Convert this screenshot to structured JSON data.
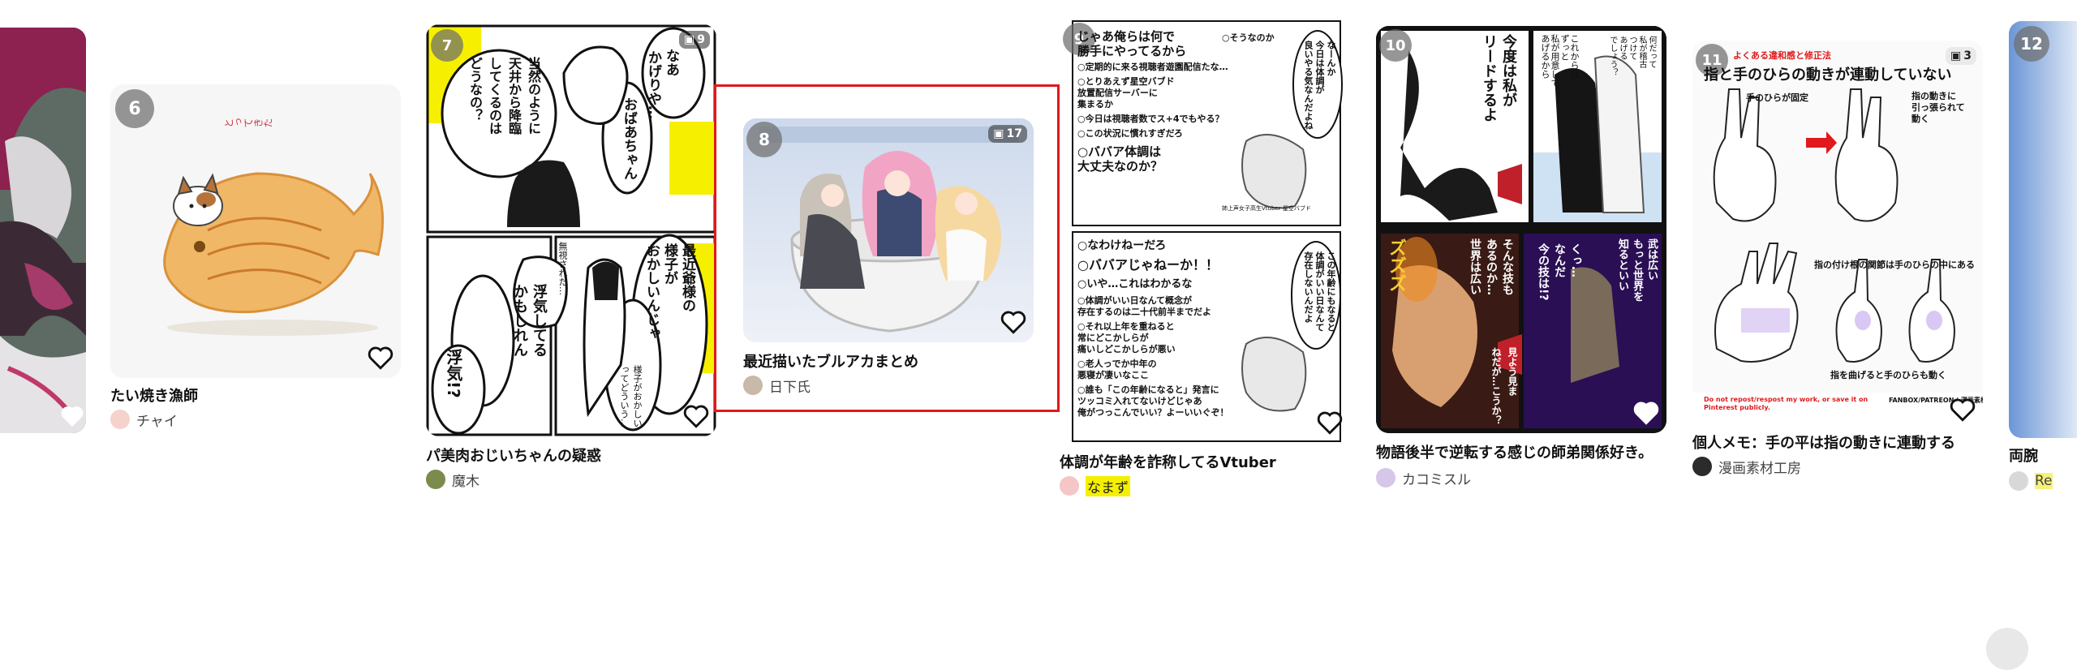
{
  "colors": {
    "selection": "#e0191b",
    "number_badge": "#6e6e6e",
    "author_highlight": "#f5f000"
  },
  "pins": [
    {
      "id": "pin5",
      "title": "",
      "author": "",
      "number": "",
      "icon": "heart-icon"
    },
    {
      "id": "pin6",
      "number": "6",
      "title": "たい焼き漁師",
      "author": "チャイ",
      "overlay_text": "とってきた"
    },
    {
      "id": "pin7",
      "number": "7",
      "count": "9",
      "title": "パ美肉おじいちゃんの疑惑",
      "author": "魔木",
      "speech": [
        "なあ",
        "かげりや…",
        "おばあちゃん",
        "当然のように",
        "天井から降臨",
        "してくるのは",
        "どうなの？",
        "最近爺様の",
        "様子が",
        "おかしいんじゃ",
        "浮気してる",
        "かもしれん",
        "浮気!?",
        "無視された…",
        "様子がおかしいってどういう…"
      ]
    },
    {
      "id": "pin8",
      "number": "8",
      "count": "17",
      "title": "最近描いたブルアカまとめ",
      "author": "日下氏"
    },
    {
      "id": "pin9",
      "number": "9",
      "title": "体調が年齢を詐称してるVtuber",
      "author": "なまず",
      "lines": [
        "じゃあ俺らは何で",
        "勝手にやってるから",
        "○そうなのか",
        "○定期的に来る視聴者遊園配信たな…",
        "○とりあえず星空バブド",
        "放置配信サーバーに",
        "集まるか",
        "○今日は視聴者数でス+4でもやる？",
        "○この状況に慣れすぎだろ",
        "○ババア体調は",
        "大丈夫なのか？",
        "姉上声女子高生Vtuber 星空バブド",
        "○なわけねーだろ",
        "○ババアじゃねーか！！",
        "○いや…これはわかるな",
        "○体調がいい日なんて概念が",
        "存在するのは二十代前半までだよ",
        "○それ以上年を重ねると",
        "常にどこかしらが",
        "痛いしどこかしらが悪い",
        "○老人っでか中年の",
        "悪寝が凄いなここ",
        "○誰も「この年齢になると」発言に",
        "ツッコミ入れてないけどじゃあ",
        "俺がつっこんでいい？よーいいぐぞ！",
        "なーんか",
        "今日は体調が",
        "良いやる気なんだよね",
        "この年齢にもなると",
        "体調がいい日なんて",
        "存在しないんだよ"
      ]
    },
    {
      "id": "pin10",
      "number": "10",
      "title": "物語後半で逆転する感じの師弟関係好き。",
      "author": "カコミスル",
      "speech": [
        "今度は私が",
        "リードするよ",
        "これからは",
        "ずっと",
        "私が用意して",
        "あげるから",
        "何だって",
        "私が稽古",
        "つけて",
        "あげる",
        "でしょう？",
        "そんな技も",
        "あるのか…",
        "世界は広い",
        "くっ…",
        "なんだ",
        "今の技は!?",
        "武は広い",
        "もっと世界を",
        "知るといい",
        "見よう見ま",
        "ねだが…こうか？",
        "ズズズ"
      ]
    },
    {
      "id": "pin11",
      "number": "11",
      "count": "3",
      "title": "個人メモ：手の平は指の動きに連動する",
      "author": "漫画素材工房",
      "doc": {
        "header": "よくある違和感と修正法",
        "headline": "指と手のひらの動きが連動していない",
        "label1": "手のひらが固定",
        "label2": "指の動きに\n引っ張られて\n動く",
        "label3": "指の付け根の関節は手のひらの中にある",
        "label4": "指を曲げると手のひらも動く",
        "footer_red": "Do not repost/respost my work, or save it on Pinterest publicly.",
        "footer_contact": "FANBOX/PATREON | 漫画素材工房"
      }
    },
    {
      "id": "pin12",
      "number": "12",
      "title": "両腕",
      "author": "Re"
    }
  ]
}
